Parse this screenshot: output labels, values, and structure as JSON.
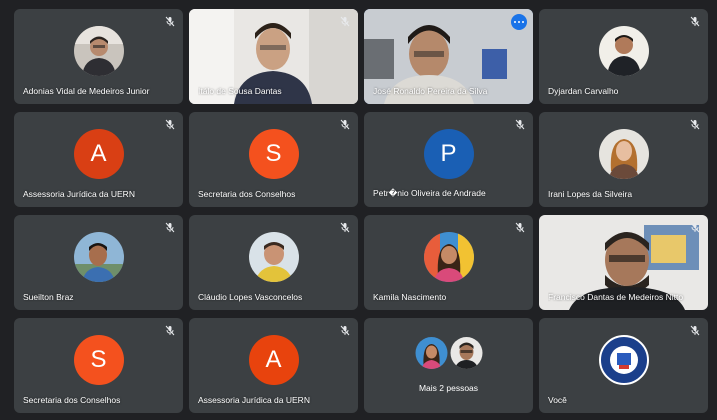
{
  "participants": [
    {
      "name": "Adonias Vidal de Medeiros Junior",
      "type": "photo"
    },
    {
      "name": "Itálo de Sousa Dantas",
      "type": "video"
    },
    {
      "name": "José Ronaldo Pereira da Silva",
      "type": "video",
      "active": true
    },
    {
      "name": "Dyjardan Carvalho",
      "type": "photo"
    },
    {
      "name": "Assessoria Jurídica da UERN",
      "type": "initial",
      "initial": "A",
      "color": "#d93f14"
    },
    {
      "name": "Secretaria dos Conselhos",
      "type": "initial",
      "initial": "S",
      "color": "#f4511e"
    },
    {
      "name": "Petr�nio Oliveira de Andrade",
      "type": "initial",
      "initial": "P",
      "color": "#1a5fb4"
    },
    {
      "name": "Irani Lopes da Silveira",
      "type": "photo"
    },
    {
      "name": "Sueilton Braz",
      "type": "photo"
    },
    {
      "name": "Cláudio Lopes Vasconcelos",
      "type": "photo"
    },
    {
      "name": "Kamila Nascimento",
      "type": "photo"
    },
    {
      "name": "Francisco Dantas de Medeiros Nitto",
      "type": "video"
    },
    {
      "name": "Secretaria dos Conselhos",
      "type": "initial",
      "initial": "S",
      "color": "#f4511e"
    },
    {
      "name": "Assessoria Jurídica da UERN",
      "type": "initial",
      "initial": "A",
      "color": "#e8430d"
    },
    {
      "name": "Mais 2 pessoas",
      "type": "group"
    },
    {
      "name": "Você",
      "type": "logo"
    }
  ],
  "icons": {
    "mute": "mic-off-icon",
    "more": "more-options-icon"
  }
}
